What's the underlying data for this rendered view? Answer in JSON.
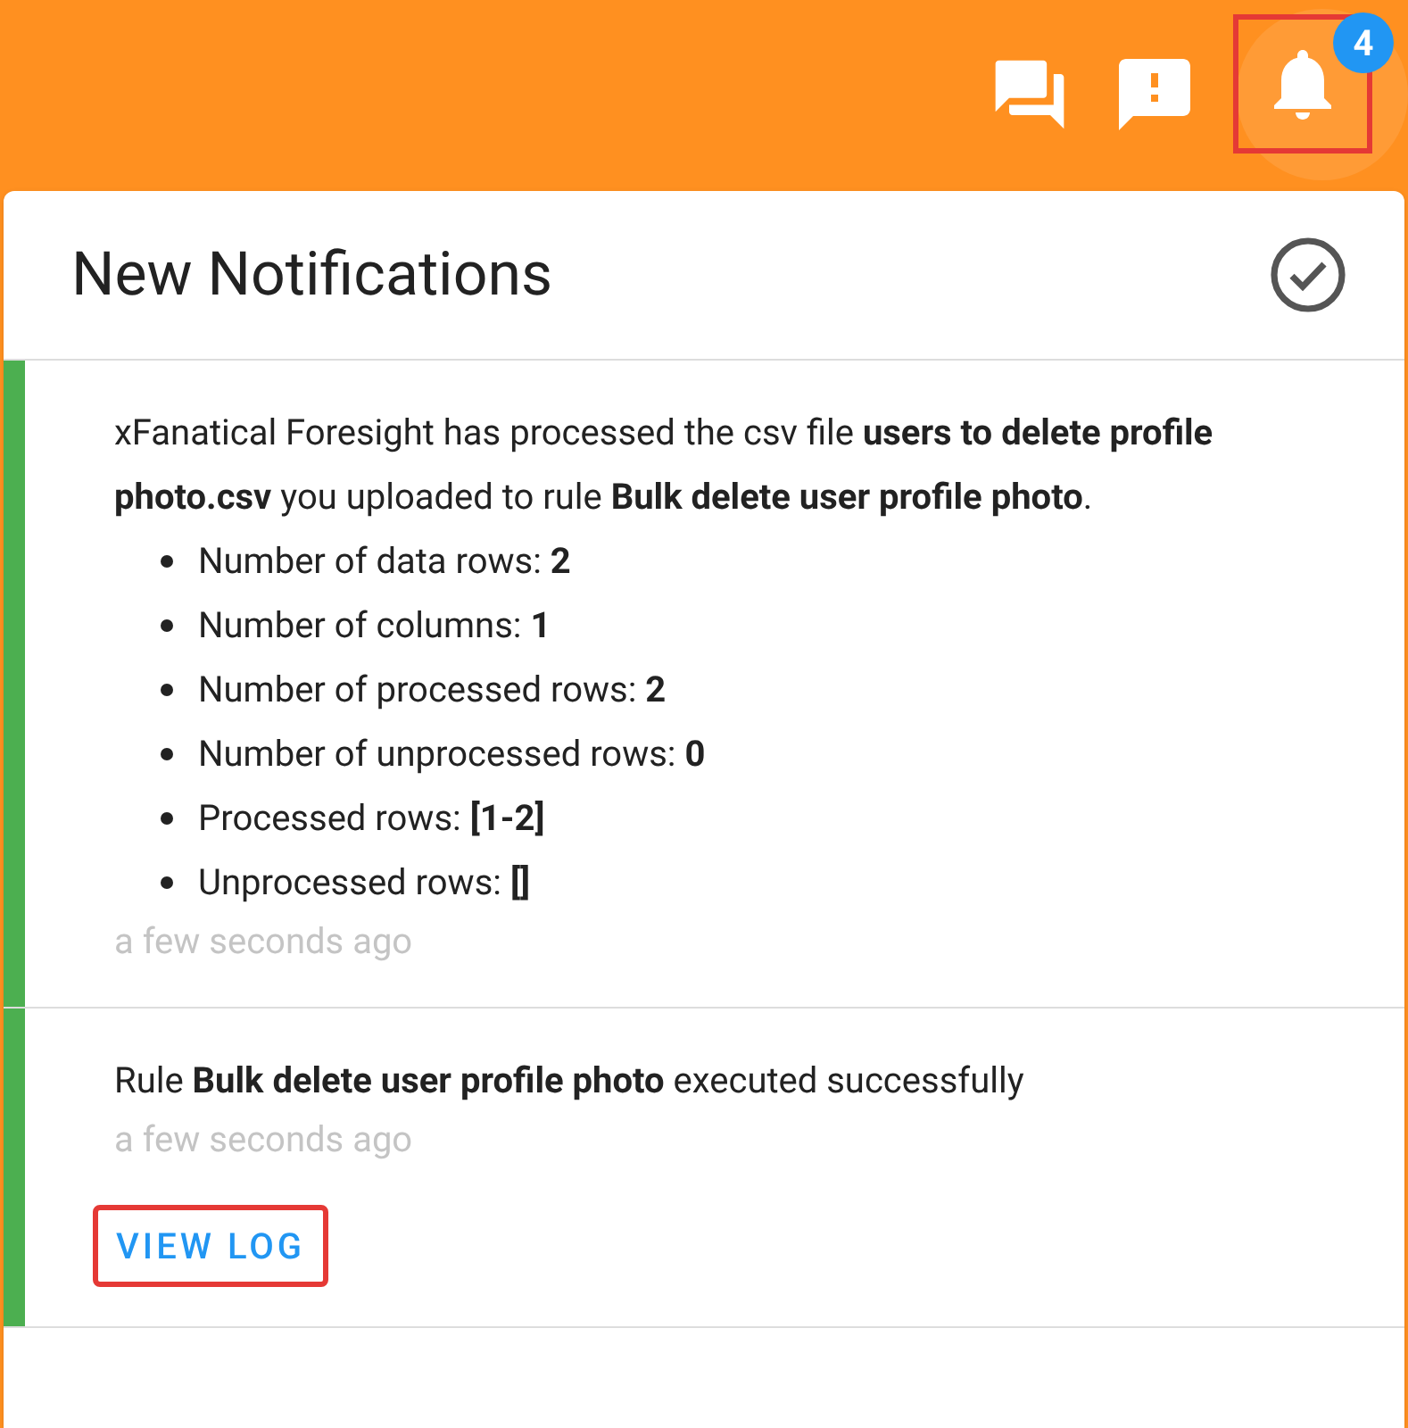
{
  "header": {
    "icons": [
      {
        "kind": "chat"
      },
      {
        "kind": "feedback"
      },
      {
        "kind": "bell",
        "badge": "4",
        "highlighted": true
      }
    ]
  },
  "panel": {
    "title": "New Notifications",
    "notifications": [
      {
        "unread": true,
        "text": "xFanatical Foresight has processed the csv file **users to delete profile photo.csv** you uploaded to rule **Bulk delete user profile photo**.",
        "bullets": [
          "Number of data rows: **2**",
          "Number of columns: **1**",
          "Number of processed rows: **2**",
          "Number of unprocessed rows: **0**",
          "Processed rows: **[1-2]**",
          "Unprocessed rows: **[]**"
        ],
        "time": "a few seconds ago"
      },
      {
        "unread": true,
        "text": "Rule **Bulk delete user profile photo** executed successfully",
        "time": "a few seconds ago",
        "action": {
          "label": "VIEW LOG",
          "highlighted": true
        }
      }
    ]
  }
}
